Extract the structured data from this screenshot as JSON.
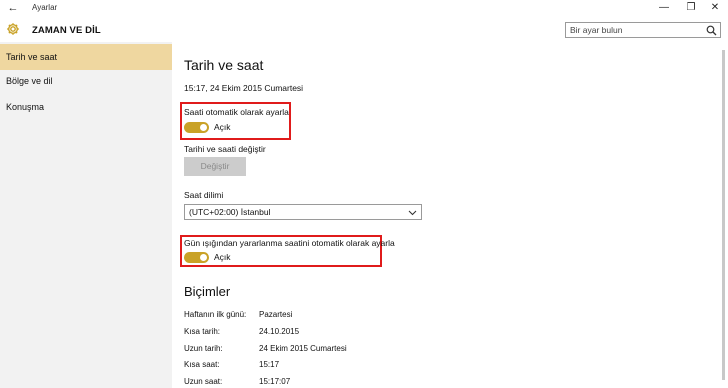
{
  "window": {
    "title": "Ayarlar",
    "back_glyph": "←",
    "minimize_glyph": "—",
    "maximize_glyph": "❐",
    "close_glyph": "✕"
  },
  "header": {
    "title": "ZAMAN VE DİL",
    "icon": "gear-icon",
    "search_placeholder": "Bir ayar bulun"
  },
  "sidebar": {
    "items": [
      {
        "label": "Tarih ve saat",
        "active": true
      },
      {
        "label": "Bölge ve dil",
        "active": false
      },
      {
        "label": "Konuşma",
        "active": false
      }
    ]
  },
  "main": {
    "title": "Tarih ve saat",
    "current_datetime": "15:17, 24 Ekim 2015 Cumartesi",
    "auto_time": {
      "label": "Saati otomatik olarak ayarla",
      "state": "Açık",
      "on": true
    },
    "change_datetime": {
      "label": "Tarihi ve saati değiştir",
      "button": "Değiştir"
    },
    "timezone": {
      "label": "Saat dilimi",
      "value": "(UTC+02:00) İstanbul"
    },
    "dst": {
      "label": "Gün ışığından yararlanma saatini otomatik olarak ayarla",
      "state": "Açık",
      "on": true
    },
    "formats": {
      "title": "Biçimler",
      "rows": [
        {
          "label": "Haftanın ilk günü:",
          "value": "Pazartesi"
        },
        {
          "label": "Kısa tarih:",
          "value": "24.10.2015"
        },
        {
          "label": "Uzun tarih:",
          "value": "24 Ekim 2015 Cumartesi"
        },
        {
          "label": "Kısa saat:",
          "value": "15:17"
        },
        {
          "label": "Uzun saat:",
          "value": "15:17:07"
        }
      ]
    }
  },
  "colors": {
    "accent": "#c9a227",
    "sidebar_active": "#efd7a0",
    "highlight_box": "#e01b1b"
  }
}
